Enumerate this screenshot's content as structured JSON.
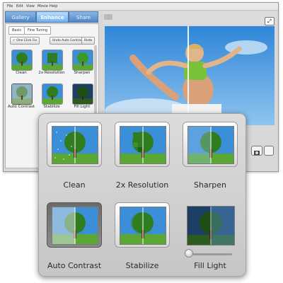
{
  "menu": {
    "items": [
      "File",
      "Edit",
      "View",
      "Movie",
      "Help"
    ]
  },
  "tabs": [
    {
      "label": "Gallery"
    },
    {
      "label": "Enhance",
      "active": true
    },
    {
      "label": "Share"
    }
  ],
  "subtabs": [
    "Basic",
    "Fine Tuning"
  ],
  "buttons": {
    "one_click_fix": "One Click Fix",
    "undo_auto_contrast": "Undo Auto Contrast",
    "redo": "Redo"
  },
  "small_grid": [
    {
      "label": "Clean",
      "icon": "clean-icon"
    },
    {
      "label": "2x Resolution",
      "icon": "resolution-icon"
    },
    {
      "label": "Sharpen",
      "icon": "sharpen-icon"
    },
    {
      "label": "Auto Contrast",
      "icon": "auto-contrast-icon"
    },
    {
      "label": "Stabilize",
      "icon": "stabilize-icon"
    },
    {
      "label": "Fill Light",
      "icon": "fill-light-icon"
    }
  ],
  "popup": {
    "items": [
      {
        "label": "Clean",
        "icon": "clean-icon"
      },
      {
        "label": "2x Resolution",
        "icon": "resolution-icon"
      },
      {
        "label": "Sharpen",
        "icon": "sharpen-icon"
      },
      {
        "label": "Auto Contrast",
        "icon": "auto-contrast-icon",
        "selected": true
      },
      {
        "label": "Stabilize",
        "icon": "stabilize-icon"
      },
      {
        "label": "Fill Light",
        "icon": "fill-light-icon"
      }
    ],
    "fill_light_level": 0
  },
  "colors": {
    "accent": "#5a9be0",
    "sky": "#3b8fd9",
    "grass": "#5aa832",
    "tree": "#2f7d1e"
  }
}
